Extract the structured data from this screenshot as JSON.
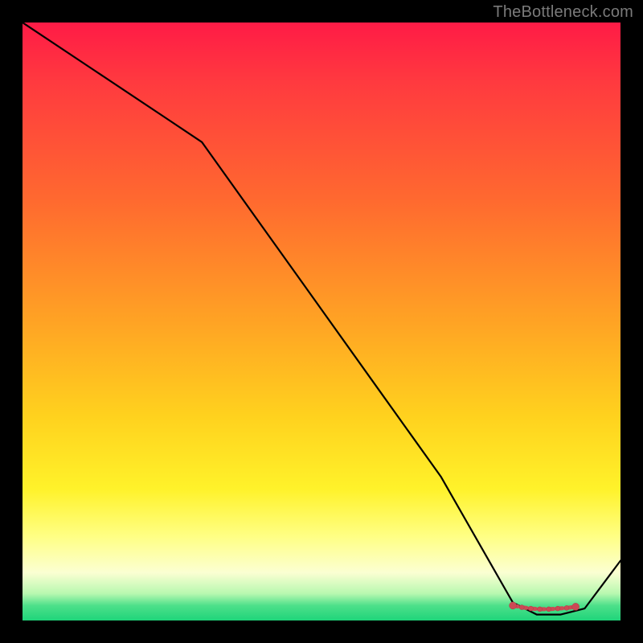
{
  "watermark": "TheBottleneck.com",
  "chart_data": {
    "type": "line",
    "title": "",
    "xlabel": "",
    "ylabel": "",
    "xlim": [
      0,
      100
    ],
    "ylim": [
      0,
      100
    ],
    "background_gradient": {
      "top_color": "#ff1b46",
      "mid_color": "#ffd21e",
      "bottom_color": "#1fd47a"
    },
    "series": [
      {
        "name": "bottleneck-curve",
        "x": [
          0,
          12,
          24,
          30,
          40,
          50,
          60,
          70,
          78,
          82,
          86,
          90,
          94,
          100
        ],
        "y": [
          100,
          92,
          84,
          80,
          66,
          52,
          38,
          24,
          10,
          3,
          1,
          1,
          2,
          10
        ]
      }
    ],
    "markers": {
      "name": "highlight-segment",
      "x": [
        82,
        83.5,
        85,
        86.5,
        88,
        89.5,
        91,
        92.5
      ],
      "y": [
        2.5,
        2.2,
        2.0,
        1.9,
        1.9,
        2.0,
        2.1,
        2.3
      ]
    }
  }
}
